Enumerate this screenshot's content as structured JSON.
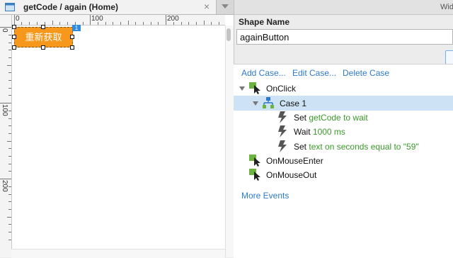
{
  "tab": {
    "title": "getCode / again (Home)",
    "close": "×"
  },
  "right_panel_title": "Wid",
  "ruler": {
    "top": [
      "0",
      "100",
      "200"
    ],
    "left": [
      "0",
      "100",
      "200"
    ]
  },
  "widget": {
    "label": "重新获取"
  },
  "shape_name": {
    "label": "Shape Name",
    "value": "againButton"
  },
  "toolbar": {
    "add_case": "Add Case...",
    "edit_case": "Edit Case...",
    "delete_case": "Delete Case"
  },
  "events": [
    {
      "name": "OnClick"
    },
    {
      "name": "OnMouseEnter"
    },
    {
      "name": "OnMouseOut"
    }
  ],
  "case": {
    "name": "Case 1"
  },
  "actions": [
    {
      "verb": "Set",
      "detail": "getCode to wait"
    },
    {
      "verb": "Wait",
      "detail": "1000 ms"
    },
    {
      "verb": "Set",
      "detail": "text on seconds equal to \"59\""
    }
  ],
  "more_events": "More Events",
  "colors": {
    "accent": "#f7981c",
    "link": "#2f7bc9",
    "action_green": "#3a9a2a",
    "selection": "#cde3f5"
  }
}
